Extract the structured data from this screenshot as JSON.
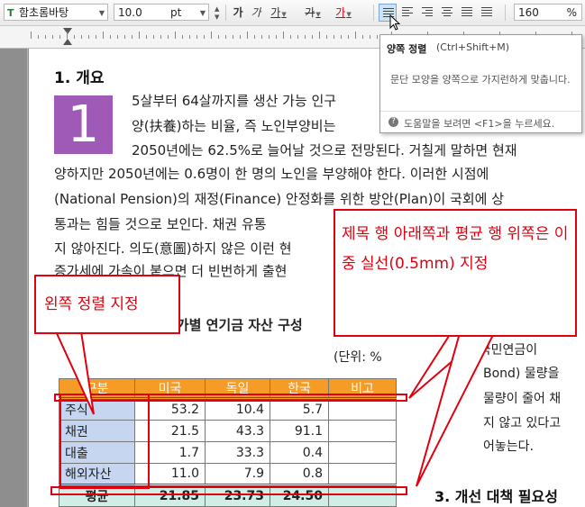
{
  "toolbar": {
    "font_name": "함초롬바탕",
    "font_size": "10.0",
    "font_unit": "pt",
    "bold": "가",
    "italic": "가",
    "underline": "가",
    "strike": "가",
    "color": "가",
    "zoom": "160",
    "zoom_unit": "%"
  },
  "document": {
    "heading1": "1. 개요",
    "dropcap": "1",
    "lines": [
      "5살부터 64살까지를 생산 가능 인구",
      "양(扶養)하는 비율, 즉 노인부양비는",
      "2050년에는 62.5%로 늘어날 것으로 전망된다. 거칠게 말하면 현재",
      "양하지만 2050년에는 0.6명이 한 명의 노인을 부양해야 한다. 이러한 시점에",
      "(National Pension)의 재정(Finance) 안정화를 위한 방안(Plan)이 국회에 상",
      "통과는 힘들 것으로 보인다. 채권 유통",
      "지 않아진다. 의도(意圖)하지 않은 이런 현",
      "증가세에 가속이 붙으면 더 빈번하게 출현"
    ],
    "table_title": "국가별 연기금 자산 구성",
    "unit_label": "(단위: %",
    "right_col": [
      "나. 국민연금이",
      "Bond) 물량을",
      "물량이 줄어 채",
      "지 않고 있다고",
      "어놓는다."
    ],
    "heading3": "3. 개선 대책 필요성"
  },
  "table": {
    "headers": [
      "구분",
      "미국",
      "독일",
      "한국",
      "비고"
    ],
    "rows": [
      [
        "주식",
        "53.2",
        "10.4",
        "5.7",
        ""
      ],
      [
        "채권",
        "21.5",
        "43.3",
        "91.1",
        ""
      ],
      [
        "대출",
        "1.7",
        "33.3",
        "0.4",
        ""
      ],
      [
        "해외자산",
        "11.0",
        "7.9",
        "0.8",
        ""
      ],
      [
        "평균",
        "21.85",
        "23.73",
        "24.50",
        ""
      ]
    ]
  },
  "tooltip": {
    "title": "양쪽 정렬",
    "shortcut": "(Ctrl+Shift+M)",
    "description": "문단 모양을 양쪽으로 가지런하게 맞춥니다.",
    "help": "도움말을 보려면 <F1>을 누르세요."
  },
  "callouts": {
    "left_align": "왼쪽 정렬 지정",
    "double_line": "제목 행 아래쪽과 평균 행 위쪽은 이중 실선(0.5mm) 지정"
  },
  "colors": {
    "dropcap": "#9f5ab7",
    "table_header": "#f79b27",
    "table_first_col": "#c7d6f0",
    "table_avg_row": "#cfeee6",
    "callout_red": "#e0000e"
  }
}
